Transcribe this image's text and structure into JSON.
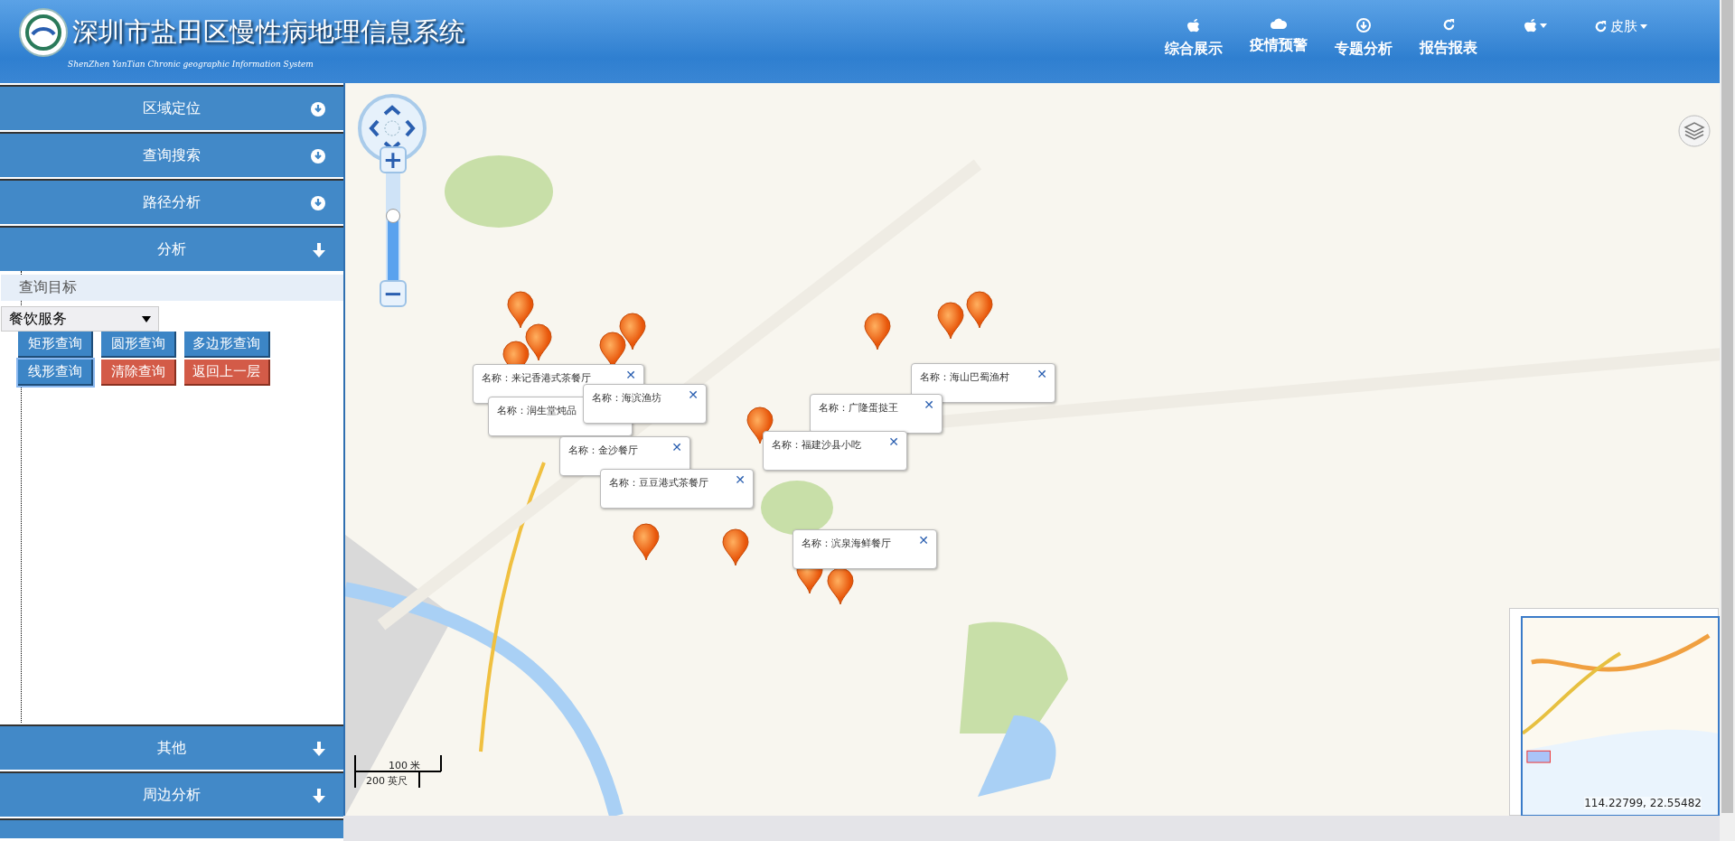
{
  "header": {
    "title": "深圳市盐田区慢性病地理信息系统",
    "subtitle": "ShenZhen YanTian Chronic geographic Information System",
    "nav": [
      {
        "label": "综合展示",
        "kind": "apple"
      },
      {
        "label": "疫情预警",
        "kind": "cloud"
      },
      {
        "label": "专题分析",
        "kind": "download"
      },
      {
        "label": "报告报表",
        "kind": "refresh"
      }
    ],
    "menus": [
      {
        "kind": "apple"
      },
      {
        "label": "皮肤",
        "kind": "refresh"
      }
    ]
  },
  "sidebar": {
    "panels_above": [
      {
        "title": "区域定位",
        "kind": "circle"
      },
      {
        "title": "查询搜索",
        "kind": "circle"
      },
      {
        "title": "路径分析",
        "kind": "circle"
      },
      {
        "title": "分析",
        "kind": "arrow"
      }
    ],
    "panels_below": [
      {
        "title": "其他",
        "kind": "arrow"
      },
      {
        "title": "周边分析",
        "kind": "arrow"
      }
    ],
    "query_target_label": "查询目标",
    "select": {
      "value": "餐饮服务"
    },
    "buttons": [
      {
        "label": "矩形查询",
        "kind": "primary",
        "focused": false
      },
      {
        "label": "圆形查询",
        "kind": "primary",
        "focused": false
      },
      {
        "label": "多边形查询",
        "kind": "primary",
        "focused": false
      },
      {
        "label": "线形查询",
        "kind": "primary",
        "focused": true
      },
      {
        "label": "清除查询",
        "kind": "danger",
        "focused": false
      },
      {
        "label": "返回上一层",
        "kind": "danger",
        "focused": false
      }
    ]
  },
  "map": {
    "popups": [
      {
        "text": "名称：来记香港式茶餐厅",
        "close": "✕"
      },
      {
        "text": "名称：润生堂炖品"
      },
      {
        "text": "名称：海滨渔坊",
        "close": "✕"
      },
      {
        "text": "名称：海山巴蜀渔村",
        "close": "✕"
      },
      {
        "text": "名称：广隆蛋挞王",
        "close": "✕"
      },
      {
        "text": "名称：福建沙县小吃",
        "close": "✕"
      },
      {
        "text": "名称：金沙餐厅",
        "close": "✕"
      },
      {
        "text": "名称：豆豆港式茶餐厅",
        "close": "✕"
      },
      {
        "text": "名称：滨泉海鲜餐厅",
        "close": "✕"
      }
    ],
    "scale": {
      "metric": "100 米",
      "imperial": "200 英尺"
    },
    "zoom": {
      "in": "+",
      "out": "−",
      "level": 0.6
    },
    "coordinates": "114.22799, 22.55482"
  }
}
